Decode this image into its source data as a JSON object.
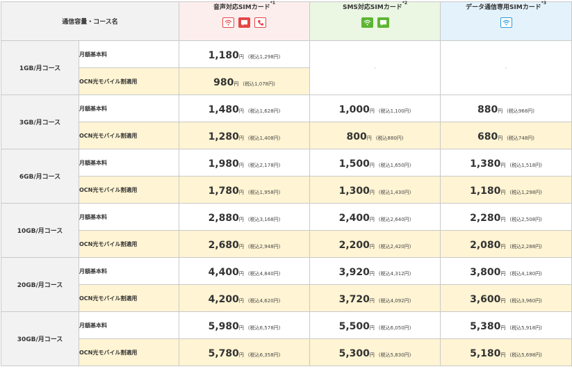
{
  "header": {
    "course_label": "通信容量・コース名",
    "sims": [
      {
        "name": "音声対応SIMカード",
        "note": "*1",
        "icons": [
          "wifi-icon",
          "sms-icon",
          "phone-icon"
        ]
      },
      {
        "name": "SMS対応SIMカード",
        "note": "*2",
        "icons": [
          "wifi-icon",
          "sms-icon"
        ]
      },
      {
        "name": "データ通信専用SIMカード",
        "note": "*3",
        "icons": [
          "wifi-icon"
        ]
      }
    ]
  },
  "labels": {
    "base": "月額基本料",
    "discount": "OCN光モバイル割適用",
    "yen": "円",
    "na": "-"
  },
  "courses": [
    {
      "name": "1GB/月コース",
      "base": [
        {
          "amt": "1,180",
          "tax": "(税込1,298円)"
        }
      ],
      "discount": [
        {
          "amt": "980",
          "tax": "(税込1,078円)"
        }
      ]
    },
    {
      "name": "3GB/月コース",
      "base": [
        {
          "amt": "1,480",
          "tax": "(税込1,628円)"
        },
        {
          "amt": "1,000",
          "tax": "(税込1,100円)"
        },
        {
          "amt": "880",
          "tax": "(税込968円)"
        }
      ],
      "discount": [
        {
          "amt": "1,280",
          "tax": "(税込1,408円)"
        },
        {
          "amt": "800",
          "tax": "(税込880円)"
        },
        {
          "amt": "680",
          "tax": "(税込748円)"
        }
      ]
    },
    {
      "name": "6GB/月コース",
      "base": [
        {
          "amt": "1,980",
          "tax": "(税込2,178円)"
        },
        {
          "amt": "1,500",
          "tax": "(税込1,650円)"
        },
        {
          "amt": "1,380",
          "tax": "(税込1,518円)"
        }
      ],
      "discount": [
        {
          "amt": "1,780",
          "tax": "(税込1,958円)"
        },
        {
          "amt": "1,300",
          "tax": "(税込1,430円)"
        },
        {
          "amt": "1,180",
          "tax": "(税込1,298円)"
        }
      ]
    },
    {
      "name": "10GB/月コース",
      "base": [
        {
          "amt": "2,880",
          "tax": "(税込3,168円)"
        },
        {
          "amt": "2,400",
          "tax": "(税込2,640円)"
        },
        {
          "amt": "2,280",
          "tax": "(税込2,508円)"
        }
      ],
      "discount": [
        {
          "amt": "2,680",
          "tax": "(税込2,948円)"
        },
        {
          "amt": "2,200",
          "tax": "(税込2,420円)"
        },
        {
          "amt": "2,080",
          "tax": "(税込2,288円)"
        }
      ]
    },
    {
      "name": "20GB/月コース",
      "base": [
        {
          "amt": "4,400",
          "tax": "(税込4,840円)"
        },
        {
          "amt": "3,920",
          "tax": "(税込4,312円)"
        },
        {
          "amt": "3,800",
          "tax": "(税込4,180円)"
        }
      ],
      "discount": [
        {
          "amt": "4,200",
          "tax": "(税込4,620円)"
        },
        {
          "amt": "3,720",
          "tax": "(税込4,092円)"
        },
        {
          "amt": "3,600",
          "tax": "(税込3,960円)"
        }
      ]
    },
    {
      "name": "30GB/月コース",
      "base": [
        {
          "amt": "5,980",
          "tax": "(税込6,578円)"
        },
        {
          "amt": "5,500",
          "tax": "(税込6,050円)"
        },
        {
          "amt": "5,380",
          "tax": "(税込5,918円)"
        }
      ],
      "discount": [
        {
          "amt": "5,780",
          "tax": "(税込6,358円)"
        },
        {
          "amt": "5,300",
          "tax": "(税込5,830円)"
        },
        {
          "amt": "5,180",
          "tax": "(税込5,698円)"
        }
      ]
    }
  ],
  "colors": {
    "header_gray": "#f2f2f2",
    "voice_header": "#fdeeee",
    "sms_header": "#ebf6e3",
    "data_header": "#e4f2fb",
    "discount_row": "#fff4d3",
    "voice_icon": "#e64545",
    "sms_icon": "#5cb532",
    "data_icon": "#2b9bd8"
  }
}
